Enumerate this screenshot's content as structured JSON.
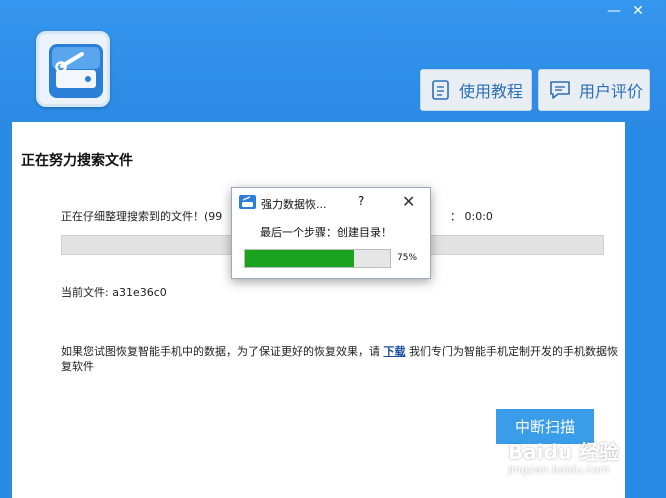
{
  "window": {
    "minimize": "—",
    "close": "✕"
  },
  "header": {
    "tutorial_label": "使用教程",
    "review_label": "用户评价"
  },
  "panel": {
    "title": "正在努力搜索文件",
    "sorting_text": "正在仔细整理搜索到的文件！(99",
    "elapsed_text": "： 0:0:0",
    "current_file_label": "当前文件: a31e36c0",
    "notice_before": "如果您试图恢复智能手机中的数据，为了保证更好的恢复效果，请 ",
    "notice_link": "下载",
    "notice_after": " 我们专门为智能手机定制开发的手机数据恢复软件",
    "stop_label": "中断扫描"
  },
  "dialog": {
    "title": "强力数据恢...",
    "help": "?",
    "close": "✕",
    "message": "最后一个步骤：创建目录！",
    "percent_label": "75%",
    "progress": 0.75
  },
  "watermark": {
    "brand": "Baidu 经验",
    "url": "jingyan.baidu.com"
  },
  "icons": {
    "logo": "hard-drive-wrench-icon",
    "tutorial": "document-icon",
    "review": "comment-icon",
    "dialog": "app-icon"
  },
  "colors": {
    "header": "#2a8be6",
    "accent": "#3a9de9",
    "progress": "#1aa31f",
    "link": "#1a4fa0"
  }
}
